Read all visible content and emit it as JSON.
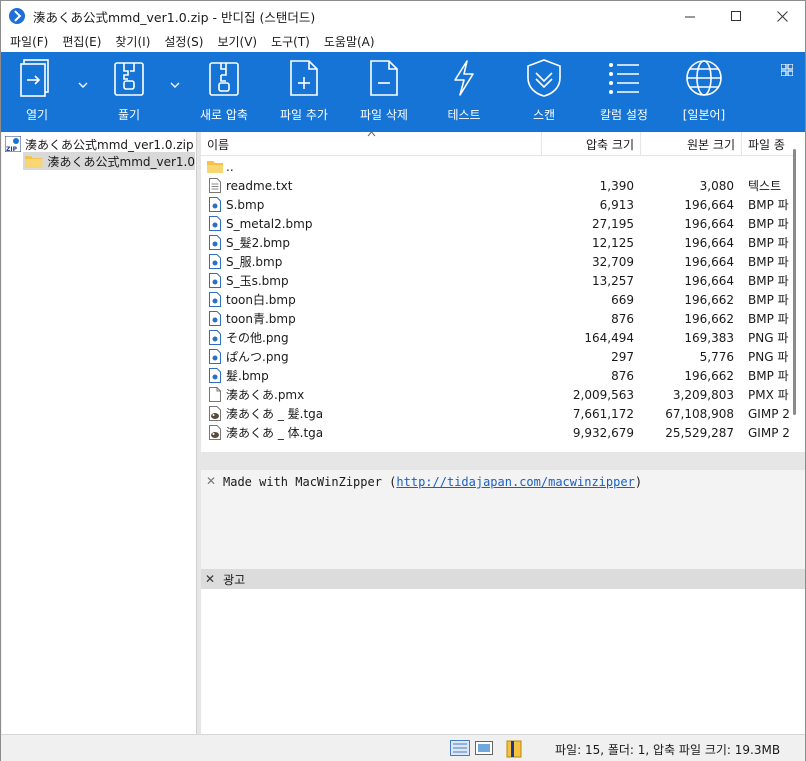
{
  "window": {
    "title": "湊あくあ公式mmd_ver1.0.zip - 반디집 (스탠더드)",
    "controls": {
      "minimize": "—",
      "maximize": "☐",
      "close": "✕"
    }
  },
  "menu": [
    "파일(F)",
    "편집(E)",
    "찾기(I)",
    "설정(S)",
    "보기(V)",
    "도구(T)",
    "도움말(A)"
  ],
  "toolbar": {
    "accent": "#1574d6",
    "buttons": [
      {
        "label": "열기",
        "icon": "open-icon"
      },
      {
        "label": "풀기",
        "icon": "extract-icon"
      },
      {
        "label": "새로 압축",
        "icon": "new-archive-icon"
      },
      {
        "label": "파일 추가",
        "icon": "add-file-icon"
      },
      {
        "label": "파일 삭제",
        "icon": "delete-file-icon"
      },
      {
        "label": "테스트",
        "icon": "test-icon"
      },
      {
        "label": "스캔",
        "icon": "scan-icon"
      },
      {
        "label": "칼럼 설정",
        "icon": "columns-icon"
      },
      {
        "label": "[일본어]",
        "icon": "globe-icon"
      }
    ]
  },
  "tree": {
    "root": "湊あくあ公式mmd_ver1.0.zip",
    "child": "湊あくあ公式mmd_ver1.0"
  },
  "filelist": {
    "columns": {
      "name": "이름",
      "packed": "압축 크기",
      "original": "원본 크기",
      "type": "파일 종"
    },
    "rows": [
      {
        "icon": "folder",
        "name": "..",
        "packed": "",
        "original": "",
        "type": ""
      },
      {
        "icon": "text",
        "name": "readme.txt",
        "packed": "1,390",
        "original": "3,080",
        "type": "텍스트"
      },
      {
        "icon": "image",
        "name": "S.bmp",
        "packed": "6,913",
        "original": "196,664",
        "type": "BMP 파"
      },
      {
        "icon": "image",
        "name": "S_metal2.bmp",
        "packed": "27,195",
        "original": "196,664",
        "type": "BMP 파"
      },
      {
        "icon": "image",
        "name": "S_髮2.bmp",
        "packed": "12,125",
        "original": "196,664",
        "type": "BMP 파"
      },
      {
        "icon": "image",
        "name": "S_服.bmp",
        "packed": "32,709",
        "original": "196,664",
        "type": "BMP 파"
      },
      {
        "icon": "image",
        "name": "S_玉s.bmp",
        "packed": "13,257",
        "original": "196,664",
        "type": "BMP 파"
      },
      {
        "icon": "image",
        "name": "toon白.bmp",
        "packed": "669",
        "original": "196,662",
        "type": "BMP 파"
      },
      {
        "icon": "image",
        "name": "toon青.bmp",
        "packed": "876",
        "original": "196,662",
        "type": "BMP 파"
      },
      {
        "icon": "image",
        "name": "その他.png",
        "packed": "164,494",
        "original": "169,383",
        "type": "PNG 파"
      },
      {
        "icon": "image",
        "name": "ぱんつ.png",
        "packed": "297",
        "original": "5,776",
        "type": "PNG 파"
      },
      {
        "icon": "image",
        "name": "髮.bmp",
        "packed": "876",
        "original": "196,662",
        "type": "BMP 파"
      },
      {
        "icon": "blank",
        "name": "湊あくあ.pmx",
        "packed": "2,009,563",
        "original": "3,209,803",
        "type": "PMX 파"
      },
      {
        "icon": "gimp",
        "name": "湊あくあ _ 髮.tga",
        "packed": "7,661,172",
        "original": "67,108,908",
        "type": "GIMP 2"
      },
      {
        "icon": "gimp",
        "name": "湊あくあ _ 体.tga",
        "packed": "9,932,679",
        "original": "25,529,287",
        "type": "GIMP 2"
      }
    ]
  },
  "comment": {
    "prefix": "Made with MacWinZipper (",
    "link": "http://tidajapan.com/macwinzipper",
    "suffix": ")"
  },
  "ad": {
    "title": "광고"
  },
  "status": {
    "summary": "파일: 15, 폴더: 1, 압축 파일 크기: 19.3MB"
  }
}
